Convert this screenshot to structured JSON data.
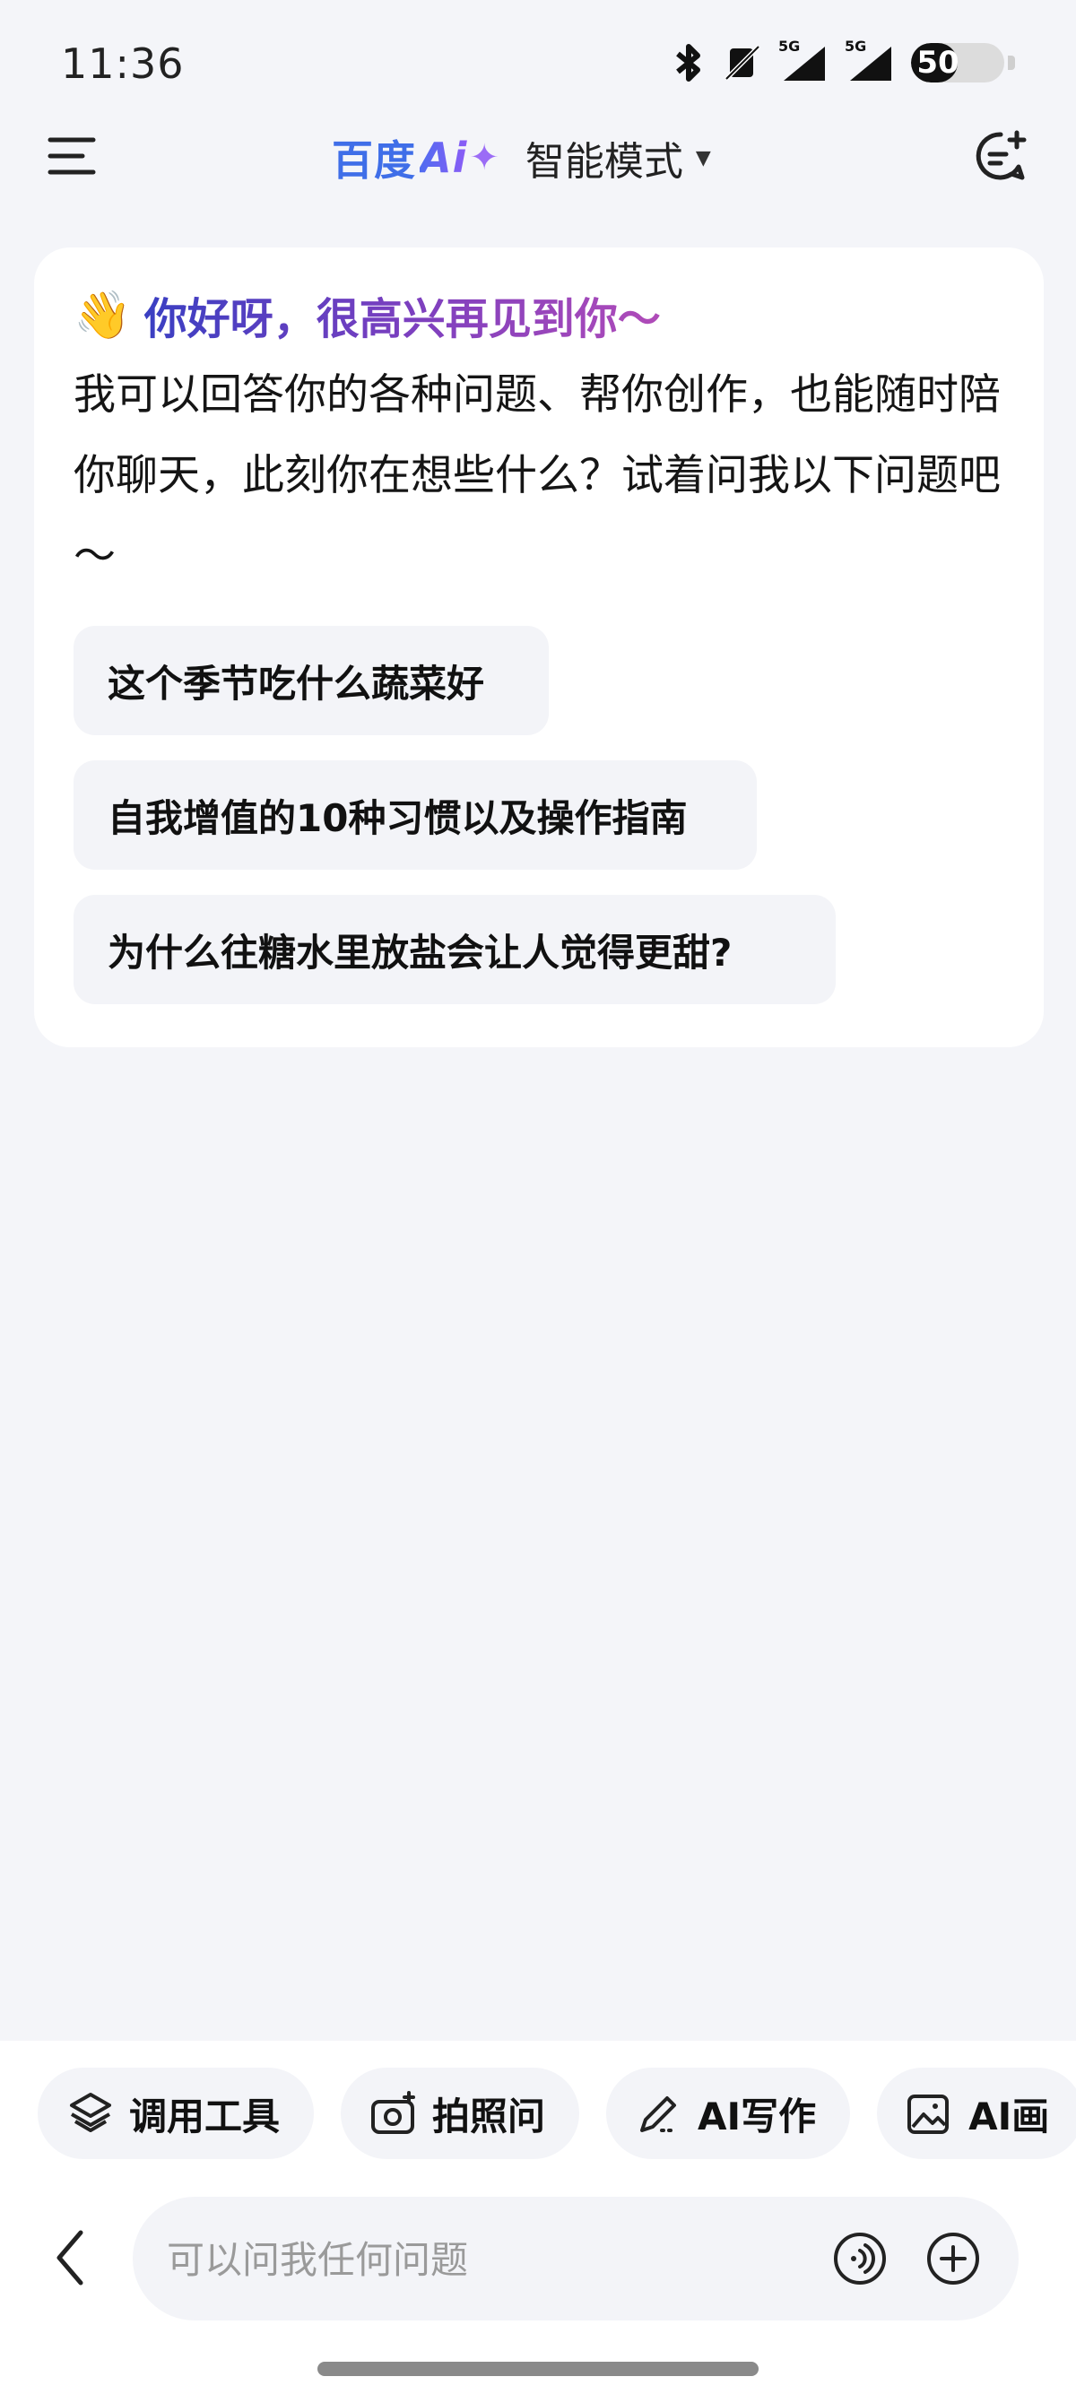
{
  "status_bar": {
    "time": "11:36",
    "network_1": "5G",
    "network_2": "5G",
    "battery_level": "50",
    "battery_fraction": 0.5
  },
  "header": {
    "logo_text": "百度",
    "logo_ai": "Ai",
    "logo_spark": "✦",
    "mode_label": "智能模式",
    "mode_caret": "▼"
  },
  "welcome": {
    "emoji": "👋",
    "greeting": "你好呀，很高兴再见到你～",
    "intro": "我可以回答你的各种问题、帮你创作，也能随时陪你聊天，此刻你在想些什么？试着问我以下问题吧～",
    "suggestions": [
      "这个季节吃什么蔬菜好",
      "自我增值的10种习惯以及操作指南",
      "为什么往糖水里放盐会让人觉得更甜?"
    ]
  },
  "tools": [
    {
      "label": "调用工具",
      "icon": "layers-icon"
    },
    {
      "label": "拍照问",
      "icon": "camera-icon"
    },
    {
      "label": "AI写作",
      "icon": "pen-icon"
    },
    {
      "label": "AI画",
      "icon": "image-icon"
    }
  ],
  "input": {
    "placeholder": "可以问我任何问题"
  },
  "colors": {
    "brand_blue": "#3f6ee8",
    "brand_purple": "#9b6cf6",
    "background": "#f4f5f9"
  }
}
